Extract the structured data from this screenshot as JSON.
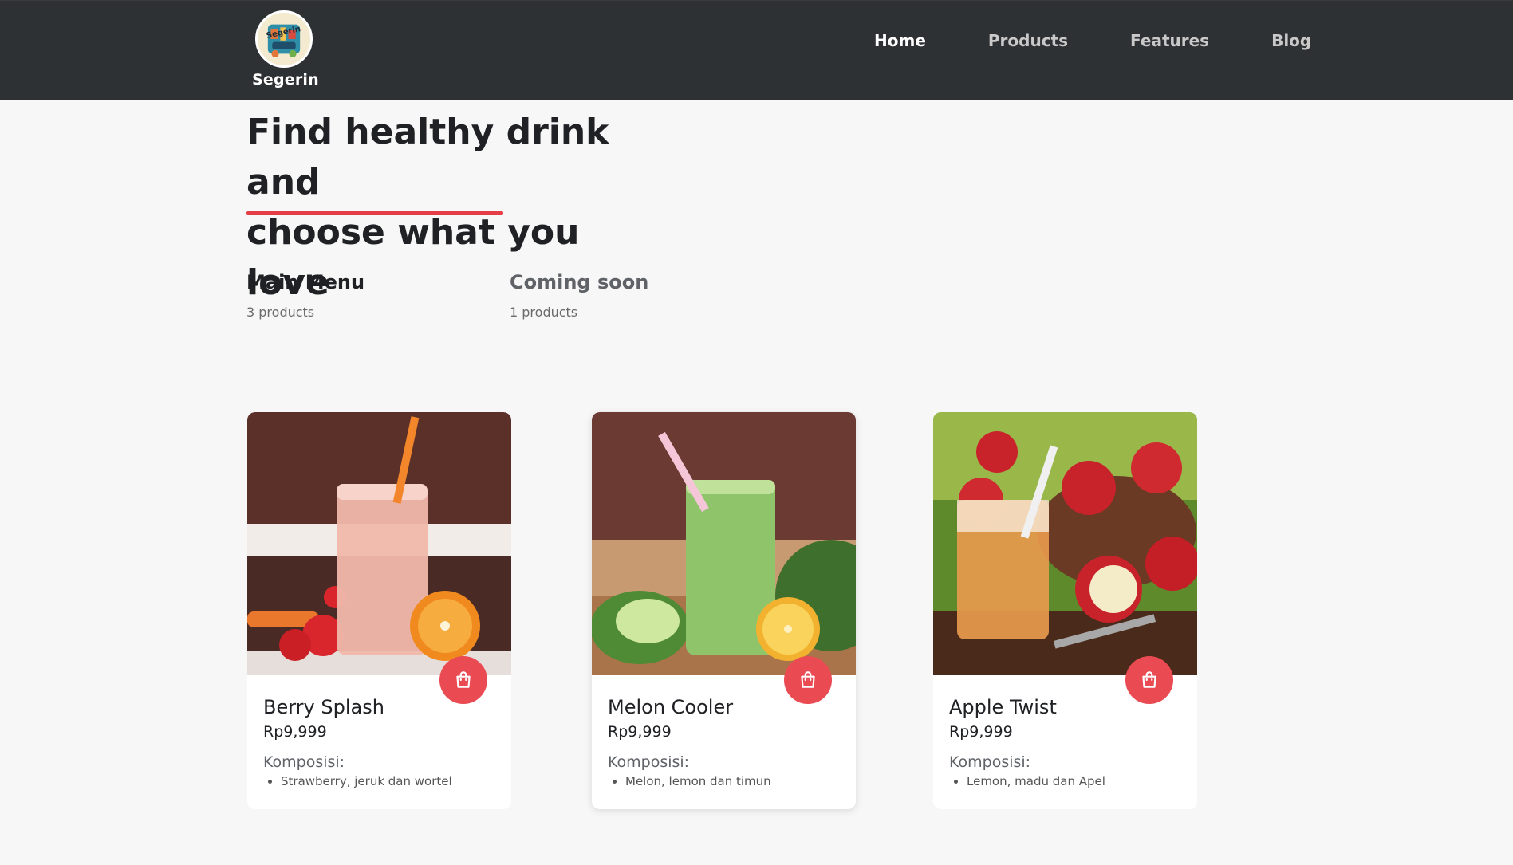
{
  "brand": {
    "name": "Segerin",
    "logo_text": "Segerin"
  },
  "nav": {
    "items": [
      {
        "label": "Home",
        "active": true
      },
      {
        "label": "Products",
        "active": false
      },
      {
        "label": "Features",
        "active": false
      },
      {
        "label": "Blog",
        "active": false
      }
    ]
  },
  "hero": {
    "title_line1": "Find healthy drink and",
    "title_line2": "choose what you love",
    "accent_color": "#e63e46"
  },
  "categories": [
    {
      "title": "Main Menu",
      "count": "3 products"
    },
    {
      "title": "Coming soon",
      "count": "1 products"
    }
  ],
  "products": [
    {
      "name": "Berry Splash",
      "price": "Rp9,999",
      "composition_label": "Komposisi:",
      "composition": "Strawberry, jeruk dan wortel",
      "image": "strawberry-smoothie-image"
    },
    {
      "name": "Melon Cooler",
      "price": "Rp9,999",
      "composition_label": "Komposisi:",
      "composition": "Melon, lemon dan timun",
      "image": "melon-smoothie-image"
    },
    {
      "name": "Apple Twist",
      "price": "Rp9,999",
      "composition_label": "Komposisi:",
      "composition": "Lemon, madu dan Apel",
      "image": "apple-drink-image"
    }
  ],
  "colors": {
    "navbar": "#2e3133",
    "cart_button": "#ea4a52",
    "background": "#f7f7f7"
  }
}
